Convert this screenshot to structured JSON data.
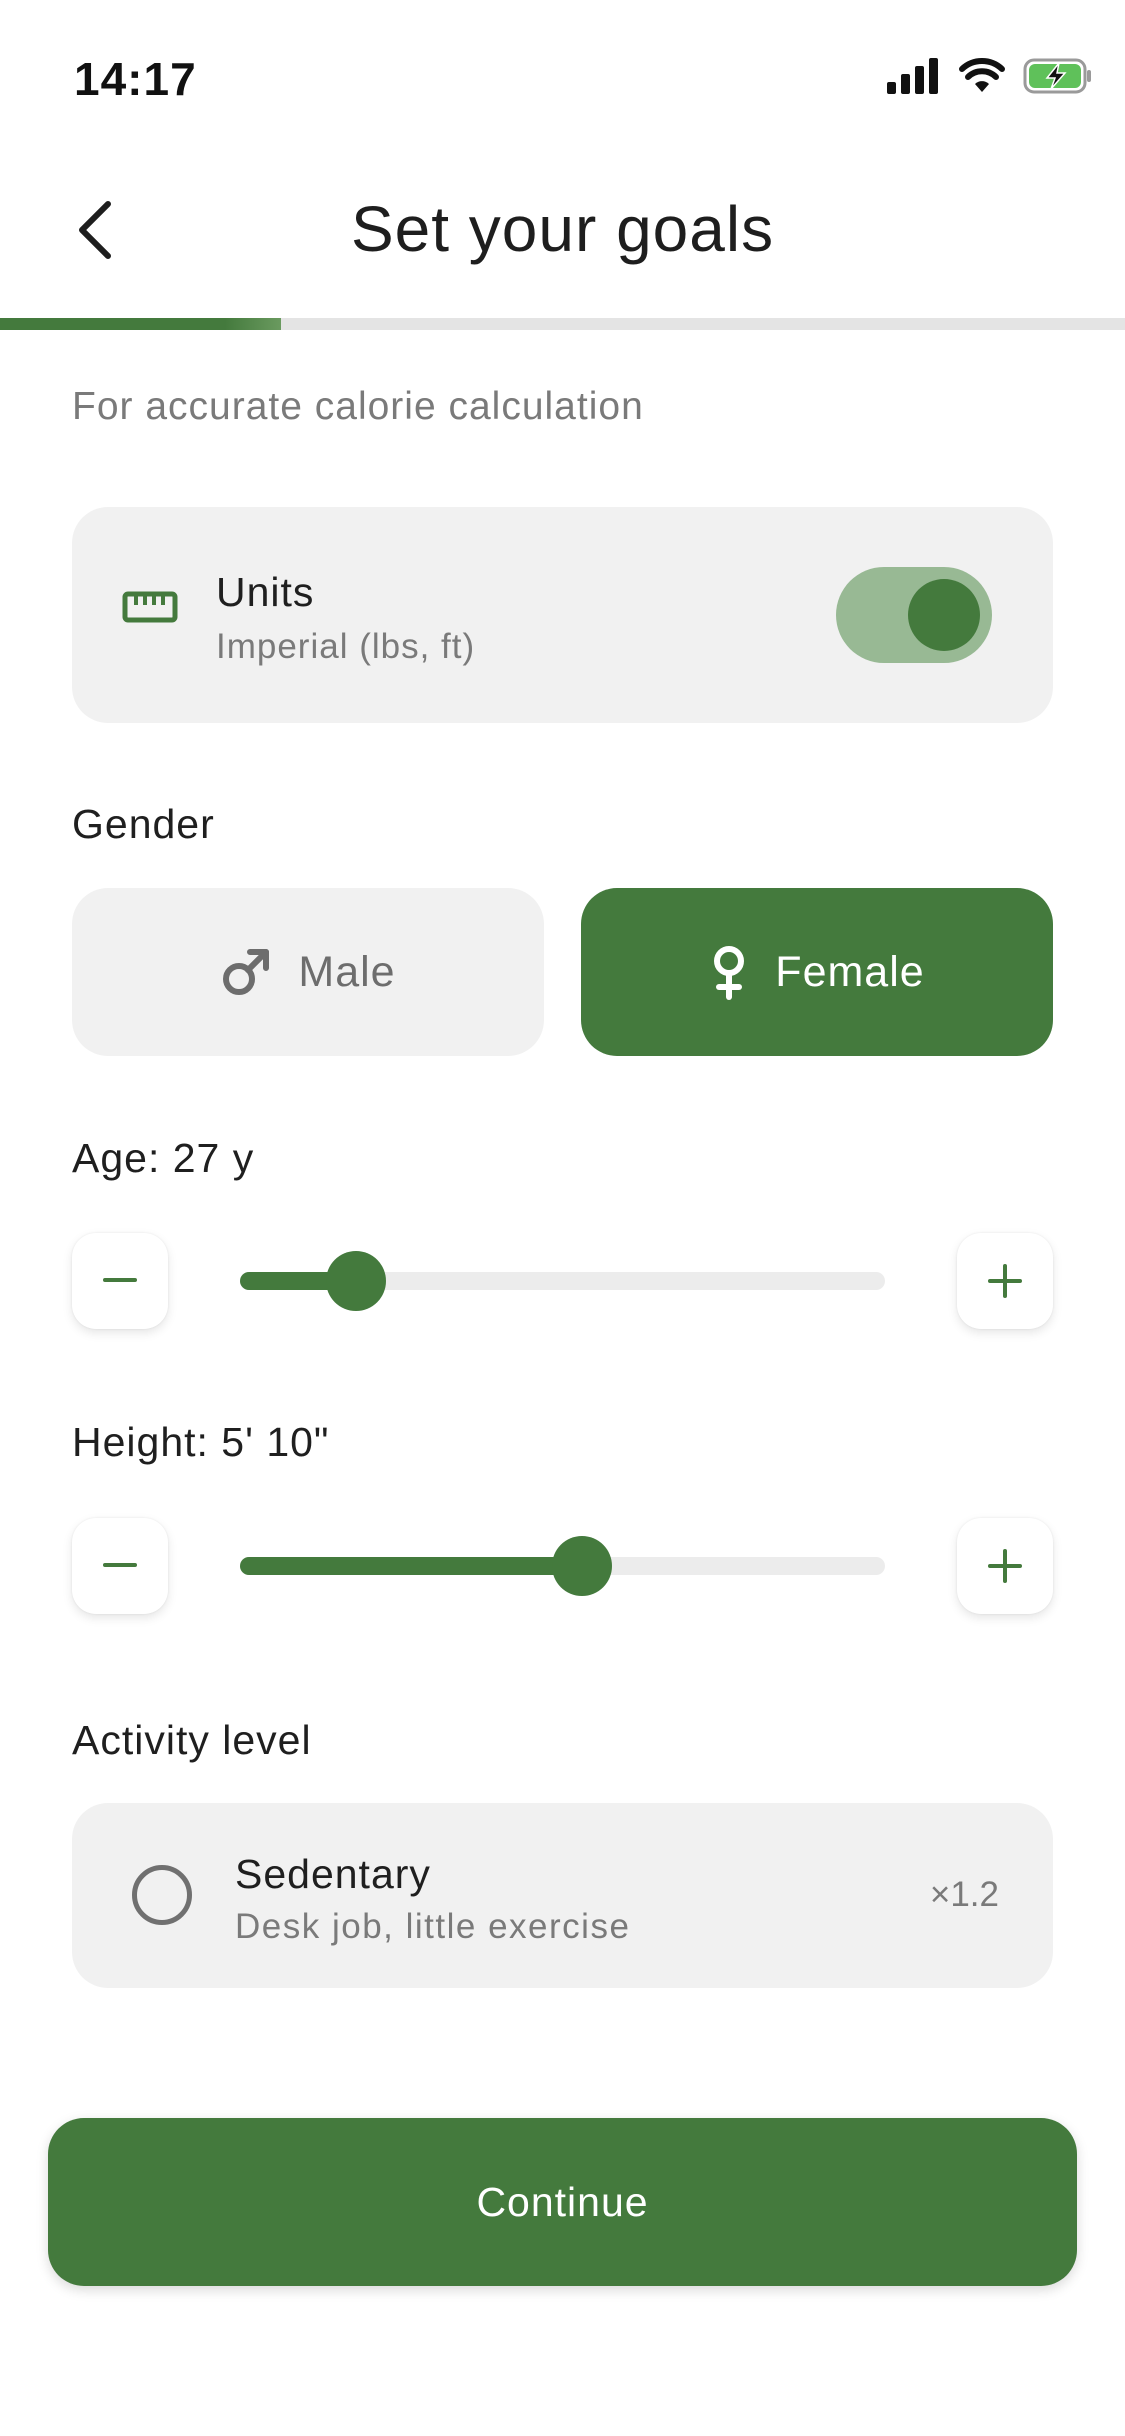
{
  "status_bar": {
    "time": "14:17"
  },
  "header": {
    "title": "Set your goals"
  },
  "progress": {
    "fraction": 0.25
  },
  "subtitle": "For accurate calorie calculation",
  "units": {
    "title": "Units",
    "value": "Imperial (lbs, ft)",
    "toggle_on": true
  },
  "gender": {
    "label": "Gender",
    "options": [
      "Male",
      "Female"
    ],
    "selected": "Female"
  },
  "age": {
    "label": "Age: 27 y",
    "slider_fraction": 0.18
  },
  "height": {
    "label": "Height: 5' 10\"",
    "slider_fraction": 0.53
  },
  "activity": {
    "label": "Activity level",
    "option": {
      "title": "Sedentary",
      "description": "Desk job, little exercise",
      "multiplier": "×1.2",
      "selected": false
    }
  },
  "continue_label": "Continue",
  "colors": {
    "accent": "#447a3d",
    "accent_light": "#98b994",
    "card_bg": "#f1f1f1",
    "muted_text": "#7a7a7a"
  }
}
